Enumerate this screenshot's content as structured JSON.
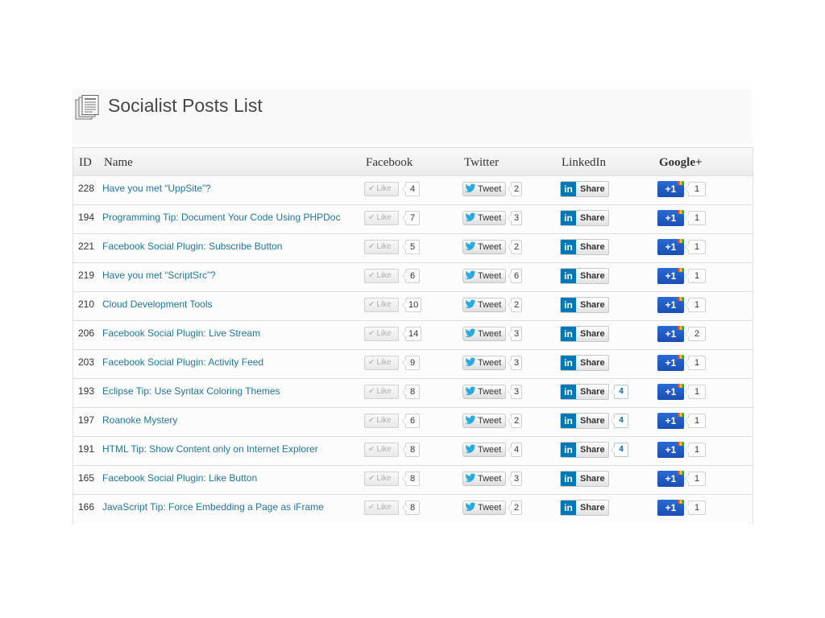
{
  "page": {
    "title": "Socialist Posts List",
    "icon": "posts-list-icon"
  },
  "table": {
    "headers": {
      "id": "ID",
      "name": "Name",
      "facebook": "Facebook",
      "twitter": "Twitter",
      "linkedin": "LinkedIn",
      "google": "Google+"
    },
    "buttons": {
      "like_label": "Like",
      "tweet_label": "Tweet",
      "share_label": "Share",
      "linkedin_logo": "in",
      "plusone_label": "+1"
    },
    "rows": [
      {
        "id": "228",
        "name": "Have you met “UppSite”?",
        "fb": "4",
        "tw": "2",
        "li": "",
        "gp": "1"
      },
      {
        "id": "194",
        "name": "Programming Tip: Document Your Code Using PHPDoc",
        "fb": "7",
        "tw": "3",
        "li": "",
        "gp": "1"
      },
      {
        "id": "221",
        "name": "Facebook Social Plugin: Subscribe Button",
        "fb": "5",
        "tw": "2",
        "li": "",
        "gp": "1"
      },
      {
        "id": "219",
        "name": "Have you met “ScriptSrc”?",
        "fb": "6",
        "tw": "6",
        "li": "",
        "gp": "1"
      },
      {
        "id": "210",
        "name": "Cloud Development Tools",
        "fb": "10",
        "tw": "2",
        "li": "",
        "gp": "1"
      },
      {
        "id": "206",
        "name": "Facebook Social Plugin: Live Stream",
        "fb": "14",
        "tw": "3",
        "li": "",
        "gp": "2"
      },
      {
        "id": "203",
        "name": "Facebook Social Plugin: Activity Feed",
        "fb": "9",
        "tw": "3",
        "li": "",
        "gp": "1"
      },
      {
        "id": "193",
        "name": "Eclipse Tip: Use Syntax Coloring Themes",
        "fb": "8",
        "tw": "3",
        "li": "4",
        "gp": "1"
      },
      {
        "id": "197",
        "name": "Roanoke Mystery",
        "fb": "6",
        "tw": "2",
        "li": "4",
        "gp": "1"
      },
      {
        "id": "191",
        "name": "HTML Tip: Show Content only on Internet Explorer",
        "fb": "8",
        "tw": "4",
        "li": "4",
        "gp": "1"
      },
      {
        "id": "165",
        "name": "Facebook Social Plugin: Like Button",
        "fb": "8",
        "tw": "3",
        "li": "",
        "gp": "1"
      },
      {
        "id": "166",
        "name": "JavaScript Tip: Force Embedding a Page as iFrame",
        "fb": "8",
        "tw": "2",
        "li": "",
        "gp": "1"
      }
    ]
  },
  "colors": {
    "link": "#21759b",
    "linkedin": "#0077b5",
    "google_plus": "#2a6ad6",
    "twitter_bird": "#2ca9e1"
  }
}
